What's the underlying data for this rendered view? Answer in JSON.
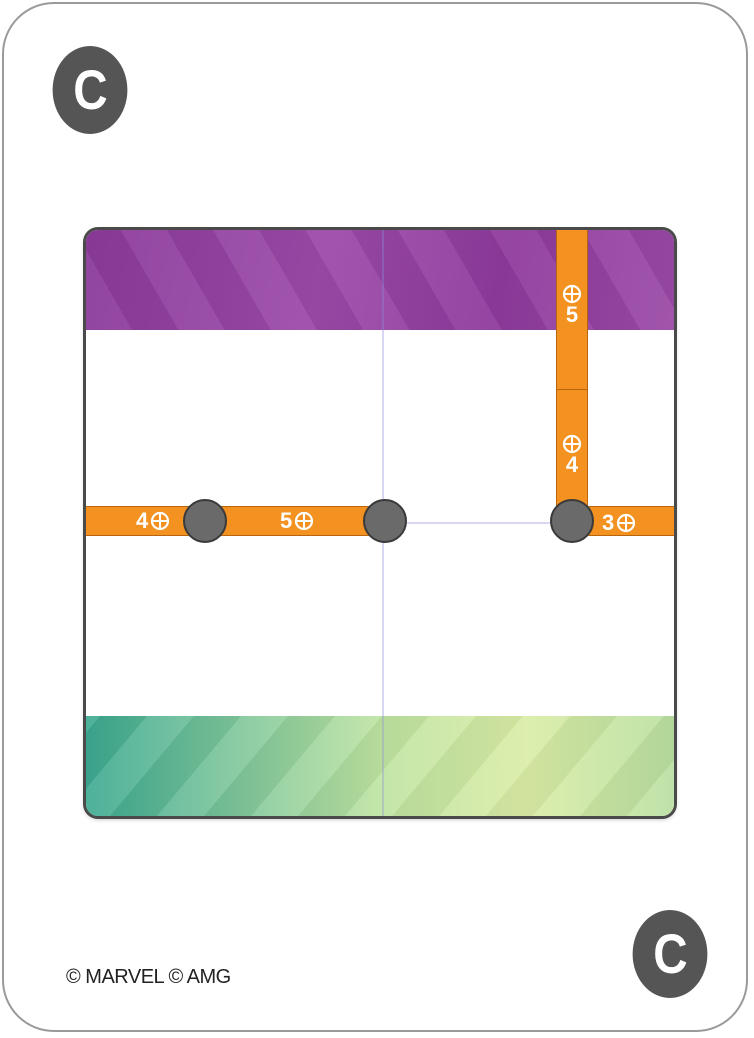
{
  "card": {
    "letter_top": "C",
    "letter_bottom": "C",
    "copyright": "© MARVEL © AMG"
  },
  "colors": {
    "badge": "#555555",
    "wall": "#f39121",
    "node": "#6a6a6a",
    "top_band": "#8e3a9c",
    "bottom_band": "#9fd6a0"
  },
  "walls": {
    "left_value_a": "4",
    "left_value_b": "5",
    "right_value": "3",
    "vertical_top_value": "5",
    "vertical_bottom_value": "4",
    "icon": "crosshair-icon"
  }
}
